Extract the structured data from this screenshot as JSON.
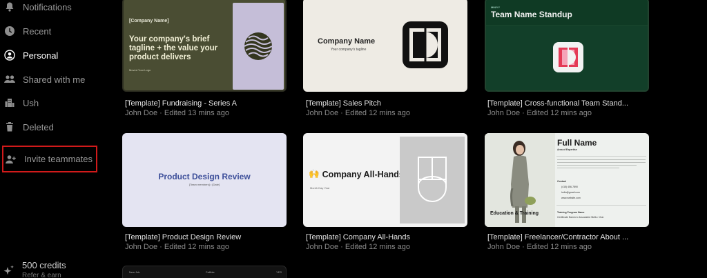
{
  "sidebar": {
    "items": [
      {
        "label": "Notifications",
        "icon": "bell-icon"
      },
      {
        "label": "Recent",
        "icon": "clock-icon"
      },
      {
        "label": "Personal",
        "icon": "user-circle-icon"
      },
      {
        "label": "Shared with me",
        "icon": "users-icon"
      },
      {
        "label": "Ush",
        "icon": "building-icon"
      },
      {
        "label": "Deleted",
        "icon": "trash-icon"
      }
    ],
    "invite_label": "Invite teammates",
    "credits_label": "500 credits",
    "credits_sub": "Refer & earn"
  },
  "cards": [
    {
      "title": "[Template] Fundraising - Series A",
      "meta": "John Doe · Edited 13 mins ago",
      "thumb": {
        "tag": "[Company Name]",
        "headline": "Your company's brief tagline + the value your product delivers",
        "footer": "Moved Your Logo"
      }
    },
    {
      "title": "[Template] Sales Pitch",
      "meta": "John Doe · Edited 12 mins ago",
      "thumb": {
        "company": "Company Name",
        "tagline": "Your company's tagline"
      }
    },
    {
      "title": "[Template] Cross-functional Team Stand...",
      "meta": "John Doe · Edited 12 mins ago",
      "thumb": {
        "small": "MM/YY",
        "headline": "Team Name Standup"
      }
    },
    {
      "title": "[Template] Product Design Review",
      "meta": "John Doe · Edited 12 mins ago",
      "thumb": {
        "headline": "Product Design Review",
        "sub": "[Team members] • [Date]"
      }
    },
    {
      "title": "[Template] Company All-Hands",
      "meta": "John Doe · Edited 12 mins ago",
      "thumb": {
        "emoji": "🙌",
        "headline": "Company All-Hands",
        "sub": "Month Day Year"
      }
    },
    {
      "title": "[Template] Freelancer/Contractor About ...",
      "meta": "John Doe · Edited 12 mins ago",
      "thumb": {
        "name": "Full Name",
        "area": "Area of Expertise",
        "contact": "Contact",
        "phone": "(415) 456-7890",
        "email": "hello@gmail.com",
        "site": "www.website.com",
        "education": "Education & Training",
        "program": "Training Program Name",
        "program_sub": "Certificate Earned • Associated Skills • Year"
      }
    },
    {
      "title": "",
      "meta": "",
      "thumb": {
        "left": "New Job",
        "mid": "Fallible",
        "right": "YES"
      }
    }
  ],
  "colors": {
    "invite_outline": "#d11a1a",
    "background": "#000000"
  }
}
